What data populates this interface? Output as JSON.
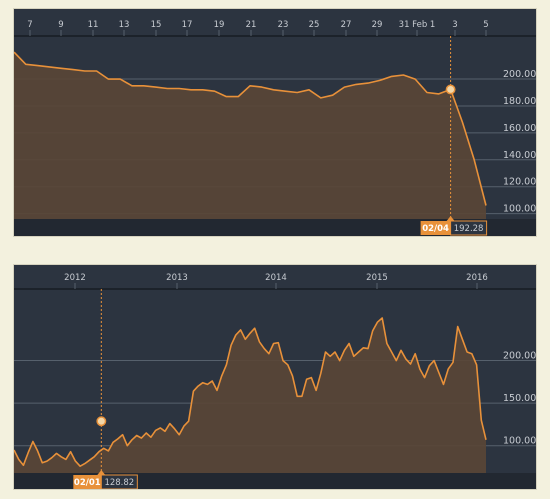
{
  "colors": {
    "background": "#2c3440",
    "axis_band": "#222831",
    "page": "#f3f1de",
    "line": "#e8913a",
    "area": "#5a4636",
    "grid": "#56606c",
    "tick_text": "#c8ccd2",
    "marker_fill": "#f3d7a8",
    "badge": "#e8913a",
    "badge_value_bg": "#2c3440"
  },
  "chart_data": [
    {
      "type": "area",
      "x_tick_labels": [
        "7",
        "9",
        "11",
        "13",
        "15",
        "17",
        "19",
        "21",
        "23",
        "25",
        "27",
        "29",
        "31 Feb 1",
        "3",
        "5"
      ],
      "y_tick_labels": [
        "200.00",
        "180.00",
        "160.00",
        "140.00",
        "120.00",
        "100.00"
      ],
      "ylim": [
        96,
        232
      ],
      "grid": true,
      "x": [
        0,
        1,
        2,
        3,
        4,
        5,
        6,
        7,
        8,
        9,
        10,
        11,
        12,
        13,
        14,
        15,
        16,
        17,
        18,
        19,
        20,
        21,
        22,
        23,
        24,
        25,
        26,
        27,
        28,
        29,
        30,
        31,
        32,
        33,
        34,
        35,
        36,
        37,
        38,
        39,
        40
      ],
      "values": [
        220,
        211,
        210,
        209,
        208,
        207,
        206,
        206,
        200,
        200,
        195,
        195,
        194,
        193,
        193,
        192,
        192,
        191,
        187,
        187,
        195,
        194,
        192,
        191,
        190,
        192,
        186,
        188,
        194,
        196,
        197,
        199,
        202,
        203,
        200,
        190,
        189,
        192.28,
        168,
        140,
        106
      ],
      "marker": {
        "x": 37,
        "value": 192.28
      },
      "marker_date_label": "02/04",
      "marker_value_label": "192.28"
    },
    {
      "type": "area",
      "x_tick_labels": [
        "2012",
        "2013",
        "2014",
        "2015",
        "2016"
      ],
      "y_tick_labels": [
        "200.00",
        "150.00",
        "100.00"
      ],
      "ylim": [
        68,
        284
      ],
      "grid": true,
      "x": [
        0,
        2,
        4,
        6,
        8,
        10,
        12,
        14,
        16,
        18,
        20,
        22,
        24,
        26,
        28,
        30,
        32,
        34,
        36,
        38,
        40,
        42,
        44,
        46,
        48,
        50,
        52,
        54,
        56,
        58,
        60,
        62,
        64,
        66,
        68,
        70,
        72,
        74,
        76,
        78,
        80,
        82,
        84,
        86,
        88,
        90,
        92,
        94,
        96,
        98,
        100,
        102,
        104,
        106,
        108,
        110,
        112,
        114,
        116,
        118,
        120,
        122,
        124,
        126,
        128,
        130,
        132,
        134,
        136,
        138,
        140,
        142,
        144,
        146,
        148,
        150,
        152,
        154,
        156,
        158,
        160,
        162,
        164,
        166,
        168,
        170,
        172,
        174,
        176,
        178,
        180,
        182,
        184,
        186,
        188,
        190,
        192,
        194,
        196,
        198,
        200
      ],
      "values": [
        95,
        84,
        77,
        92,
        105,
        94,
        80,
        82,
        86,
        91,
        87,
        84,
        93,
        82,
        76,
        79,
        83,
        87,
        93,
        97,
        94,
        104,
        108,
        113,
        100,
        107,
        112,
        109,
        115,
        110,
        118,
        121,
        117,
        126,
        120,
        113,
        123,
        128.82,
        164,
        170,
        174,
        172,
        176,
        165,
        182,
        195,
        218,
        230,
        236,
        225,
        232,
        238,
        222,
        214,
        208,
        220,
        221,
        200,
        195,
        182,
        158,
        158,
        178,
        180,
        165,
        185,
        210,
        205,
        210,
        200,
        212,
        220,
        205,
        210,
        215,
        214,
        235,
        245,
        250,
        220,
        210,
        200,
        212,
        202,
        196,
        208,
        190,
        180,
        194,
        200,
        186,
        172,
        190,
        198,
        240,
        225,
        210,
        208,
        195,
        130,
        107
      ],
      "marker": {
        "x": 37,
        "value": 128.82
      },
      "marker_date_label": "02/01",
      "marker_value_label": "128.82"
    }
  ]
}
